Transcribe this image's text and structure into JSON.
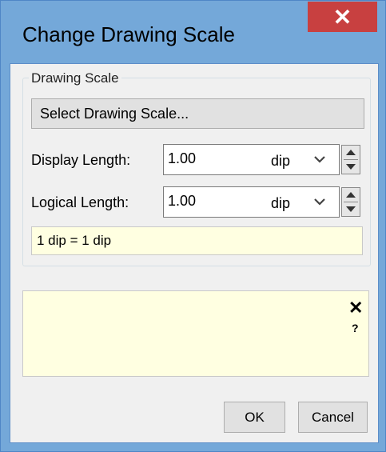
{
  "dialog": {
    "title": "Change Drawing Scale",
    "close_glyph": "✕"
  },
  "drawing_scale": {
    "group_label": "Drawing Scale",
    "select_button_label": "Select Drawing Scale...",
    "display_length": {
      "label": "Display Length:",
      "value": "1.00",
      "unit": "dip"
    },
    "logical_length": {
      "label": "Logical Length:",
      "value": "1.00",
      "unit": "dip"
    },
    "equivalence_text": "1 dip = 1 dip"
  },
  "message_panel": {
    "close_glyph": "✕",
    "help_glyph": "?"
  },
  "buttons": {
    "ok_label": "OK",
    "cancel_label": "Cancel"
  },
  "icons": {
    "dropdown": "chevron-down-icon",
    "spin_up": "arrow-up-icon",
    "spin_down": "arrow-down-icon"
  },
  "colors": {
    "titlebar": "#74a8d9",
    "close_button": "#c84040",
    "info_background": "#ffffe1"
  }
}
